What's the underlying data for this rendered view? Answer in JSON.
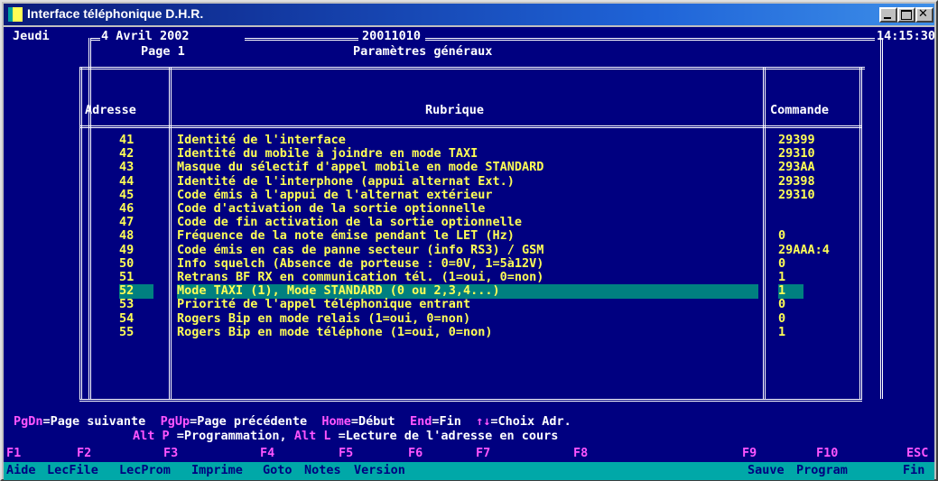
{
  "window": {
    "title": "Interface téléphonique D.H.R."
  },
  "header": {
    "day": "Jeudi",
    "date": "4 Avril 2002",
    "version": "20011010",
    "time": "14:15:30",
    "page": "Page 1",
    "section_title": "Paramètres généraux"
  },
  "table": {
    "columns": [
      "Adresse",
      "Rubrique",
      "Commande"
    ],
    "selected_address": "52",
    "rows": [
      {
        "addr": "41",
        "label": "Identité de l'interface",
        "cmd": "29399"
      },
      {
        "addr": "42",
        "label": "Identité du mobile à joindre en mode TAXI",
        "cmd": "29310"
      },
      {
        "addr": "43",
        "label": "Masque du sélectif d'appel mobile en mode STANDARD",
        "cmd": "293AA"
      },
      {
        "addr": "44",
        "label": "Identité de l'interphone (appui alternat Ext.)",
        "cmd": "29398"
      },
      {
        "addr": "45",
        "label": "Code émis à l'appui de l'alternat extérieur",
        "cmd": "29310"
      },
      {
        "addr": "46",
        "label": "Code d'activation de la sortie optionnelle",
        "cmd": ""
      },
      {
        "addr": "47",
        "label": "Code de fin activation de la sortie optionnelle",
        "cmd": ""
      },
      {
        "addr": "48",
        "label": "Fréquence de la note émise pendant le LET (Hz)",
        "cmd": "0"
      },
      {
        "addr": "49",
        "label": "Code émis en cas de panne secteur (info RS3) / GSM",
        "cmd": "29AAA:4"
      },
      {
        "addr": "50",
        "label": "Info squelch (Absence de porteuse : 0=0V, 1=5à12V)",
        "cmd": "0"
      },
      {
        "addr": "51",
        "label": "Retrans BF RX en communication tél. (1=oui, 0=non)",
        "cmd": "1"
      },
      {
        "addr": "52",
        "label": "Mode TAXI (1), Mode STANDARD (0 ou 2,3,4...)",
        "cmd": "1"
      },
      {
        "addr": "53",
        "label": "Priorité de l'appel téléphonique entrant",
        "cmd": "0"
      },
      {
        "addr": "54",
        "label": "Rogers Bip en mode relais (1=oui, 0=non)",
        "cmd": "0"
      },
      {
        "addr": "55",
        "label": "Rogers Bip en mode téléphone (1=oui, 0=non)",
        "cmd": "1"
      }
    ]
  },
  "help": {
    "pgdn_key": "PgDn",
    "pgdn_text": "=Page suivante",
    "pgup_key": "PgUp",
    "pgup_text": "=Page précédente",
    "home_key": "Home",
    "home_text": "=Début",
    "end_key": "End",
    "end_text": "=Fin",
    "arrows_key": "↑↓",
    "arrows_text": "=Choix Adr.",
    "altp_key": "Alt P",
    "altp_text": " =Programmation,",
    "altl_key": "Alt L",
    "altl_text": " =Lecture de l'adresse en cours"
  },
  "fkeys": [
    "F1",
    "F2",
    "F3",
    "F4",
    "F5",
    "F6",
    "F7",
    "F8",
    "F9",
    "F10",
    "ESC"
  ],
  "menubar": [
    "Aide",
    "LecFile",
    "LecProm",
    "Imprime",
    "Goto",
    "Notes",
    "Version",
    "Sauve",
    "Program",
    "Fin"
  ],
  "colors": {
    "console_bg": "#000080",
    "text_yellow": "#ffff55",
    "text_magenta": "#ff55ff",
    "selection": "#008080",
    "menubar_bg": "#00a8a8"
  }
}
